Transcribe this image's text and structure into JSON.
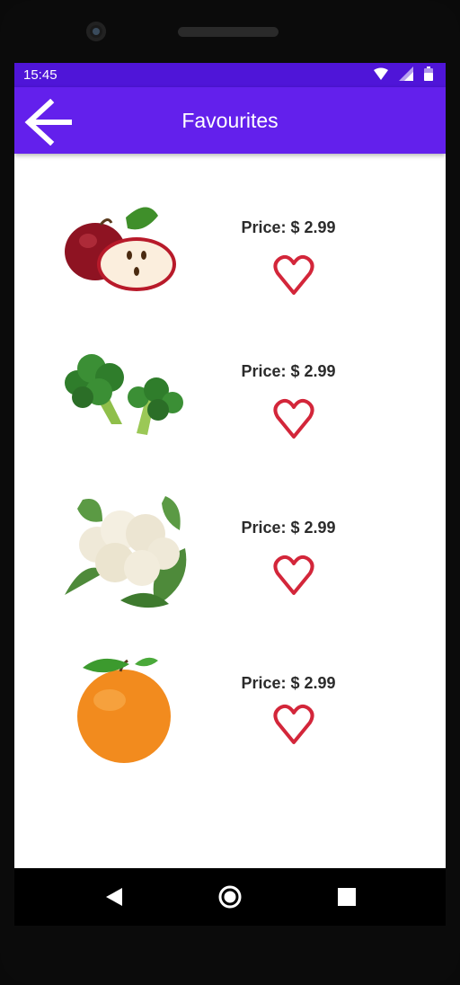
{
  "status_bar": {
    "time": "15:45",
    "icons": [
      "wifi-icon",
      "signal-icon",
      "battery-icon"
    ]
  },
  "app_bar": {
    "title": "Favourites",
    "back_icon": "arrow-left-icon",
    "color": "#6320ec"
  },
  "favourites": [
    {
      "product": "apple",
      "price_label": "Price: $ 2.99",
      "heart_icon": "heart-outline-icon"
    },
    {
      "product": "broccoli",
      "price_label": "Price: $ 2.99",
      "heart_icon": "heart-outline-icon"
    },
    {
      "product": "cauliflower",
      "price_label": "Price: $ 2.99",
      "heart_icon": "heart-outline-icon"
    },
    {
      "product": "orange",
      "price_label": "Price: $ 2.99",
      "heart_icon": "heart-outline-icon"
    }
  ],
  "colors": {
    "status_bar": "#4f15d8",
    "app_bar": "#6320ec",
    "heart": "#d3263a",
    "price_text": "#2b2b2b"
  },
  "nav_bar": {
    "icons": [
      "back-triangle-icon",
      "home-circle-icon",
      "recents-square-icon"
    ]
  }
}
